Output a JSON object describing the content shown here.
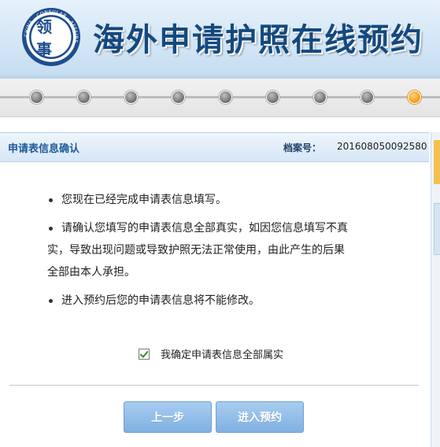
{
  "banner": {
    "title": "海外申请护照在线预约",
    "logo_icon": "consular-affairs-logo-icon",
    "logo_ring_text": "CHINA · CONSULAR · AFFAIRS",
    "logo_glyph": "领事"
  },
  "progress": {
    "total_steps": 9,
    "active_step": 9,
    "inactive_color": "#7a7a7a",
    "active_color": "#f29a10"
  },
  "panel": {
    "title": "申请表信息确认",
    "file_label": "档案号：",
    "file_number": "201608050092580"
  },
  "notices": [
    {
      "line1": "您现在已经完成申请表信息填写。"
    },
    {
      "line1": "请确认您填写的申请表信息全部真实，如因您信息填写不真",
      "line2": "实，导致出现问题或导致护照无法正常使用，由此产生的后果",
      "line3": "全部由本人承担。"
    },
    {
      "line1": "进入预约后您的申请表信息将不能修改。"
    }
  ],
  "confirm": {
    "label": "我确定申请表信息全部属实",
    "checked": true
  },
  "buttons": {
    "prev_label": "上一步",
    "next_label": "进入预约"
  },
  "colors": {
    "accent": "#1f5a99",
    "button": "#7fb0e2"
  }
}
